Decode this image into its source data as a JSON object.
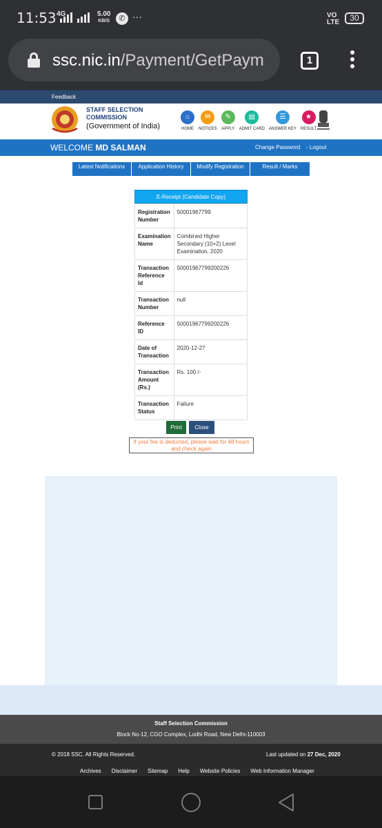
{
  "status_bar": {
    "time": "11:53",
    "network": "4G",
    "speed_value": "5.00",
    "speed_unit": "KB/S",
    "volte": "VO\nLTE",
    "battery": "30"
  },
  "browser": {
    "url_host": "ssc.nic.in",
    "url_path": "/Payment/GetPaym",
    "tab_count": "1"
  },
  "site": {
    "feedback": "Feedback",
    "org_line1": "STAFF SELECTION",
    "org_line2": "COMMISSION",
    "org_sub": "(Government of India)",
    "nav_icons": [
      {
        "label": "HOME",
        "color": "#2a6fc9",
        "icon": "home-icon"
      },
      {
        "label": "NOTICES",
        "color": "#f39c12",
        "icon": "notices-icon"
      },
      {
        "label": "APPLY",
        "color": "#5cb85c",
        "icon": "apply-icon"
      },
      {
        "label": "ADMIT CARD",
        "color": "#1abc9c",
        "icon": "admit-card-icon"
      },
      {
        "label": "ANSWER KEY",
        "color": "#3498db",
        "icon": "answer-key-icon"
      },
      {
        "label": "RESULT",
        "color": "#d81b60",
        "icon": "result-icon"
      }
    ],
    "welcome_prefix": "WELCOME ",
    "user_name": "MD SALMAN",
    "change_password": "Change Password",
    "logout": "- Logout",
    "tabs": [
      "Latest Notifications",
      "Application History",
      "Modify Registration",
      "Result / Marks"
    ]
  },
  "receipt": {
    "title": "E-Receipt (Candidate Copy)",
    "rows": [
      {
        "key": "Registration Number",
        "value": "50001967799"
      },
      {
        "key": "Examination Name",
        "value": "Combined Higher Secondary (10+2) Level Examination, 2020"
      },
      {
        "key": "Transaction Reference Id",
        "value": "500019677992002​26"
      },
      {
        "key": "Transaction Number",
        "value": "null"
      },
      {
        "key": "Reference ID",
        "value": "500019677992002​26"
      },
      {
        "key": "Date of Transaction",
        "value": "2020-12-27"
      },
      {
        "key": "Transaction Amount (Rs.)",
        "value": "Rs. 100 /-"
      },
      {
        "key": "Transaction Status",
        "value": "Failure"
      }
    ]
  },
  "actions": {
    "print": "Print",
    "close": "Close",
    "notice": "If your fee is deducted, please wait for 48 hours and check again"
  },
  "footer": {
    "org": "Staff Selection Commission",
    "address": "Block No-12, CGO Complex, Lodhi Road, New Delhi-110003",
    "copyright": "© 2018 SSC. All Rights Reserved.",
    "last_updated_prefix": "Last updated on ",
    "last_updated_date": "27 Dec, 2020",
    "links": [
      "Archives",
      "Disclaimer",
      "Sitemap",
      "Help",
      "Website Policies",
      "Web Information Manager"
    ]
  },
  "colors": {
    "header_strip": "#2c4a6e",
    "welcome_bar": "#1f73c4",
    "receipt_head": "#12a5f0",
    "print_btn": "#1f6b3a",
    "close_btn": "#2c4f7c",
    "notice_text": "#f07a3a"
  }
}
